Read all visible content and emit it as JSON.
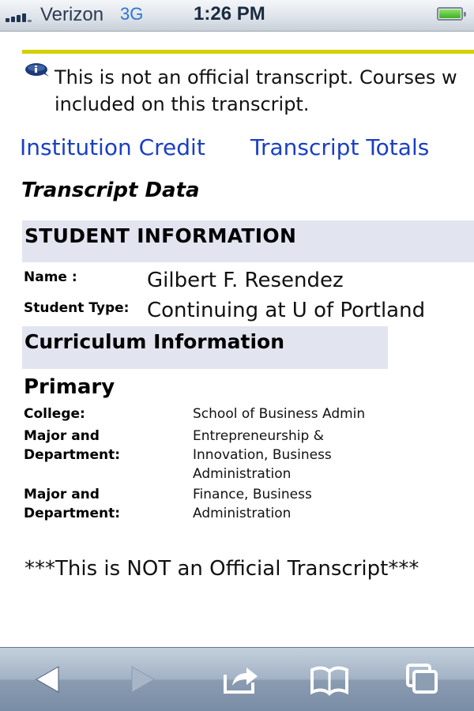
{
  "status_bar": {
    "carrier": "Verizon",
    "network": "3G",
    "time": "1:26 PM"
  },
  "notice": {
    "icon": "info-icon",
    "text": "This is not an official transcript. Courses w\nincluded on this transcript."
  },
  "links": {
    "institution_credit": "Institution Credit",
    "transcript_totals": "Transcript Totals"
  },
  "section_title": "Transcript Data",
  "student_information": {
    "header": "STUDENT INFORMATION",
    "name_label": "Name :",
    "name_value": "Gilbert F. Resendez",
    "type_label": "Student Type:",
    "type_value": "Continuing at U of Portland"
  },
  "curriculum": {
    "header": "Curriculum Information",
    "primary_label": "Primary",
    "rows": [
      {
        "label": "College:",
        "value": "School of Business Admin"
      },
      {
        "label": "Major and\nDepartment:",
        "value": "Entrepreneurship &\nInnovation, Business\nAdministration"
      },
      {
        "label": "Major and\nDepartment:",
        "value": "Finance, Business\nAdministration"
      }
    ]
  },
  "footer_note": "***This is NOT an Official Transcript***",
  "toolbar": {
    "icons": [
      "back-icon",
      "forward-icon",
      "share-icon",
      "bookmarks-icon",
      "tabs-icon"
    ]
  },
  "colors": {
    "link": "#1a3fc4",
    "header_band": "#e2e5ef",
    "rule": "#d3d100"
  }
}
